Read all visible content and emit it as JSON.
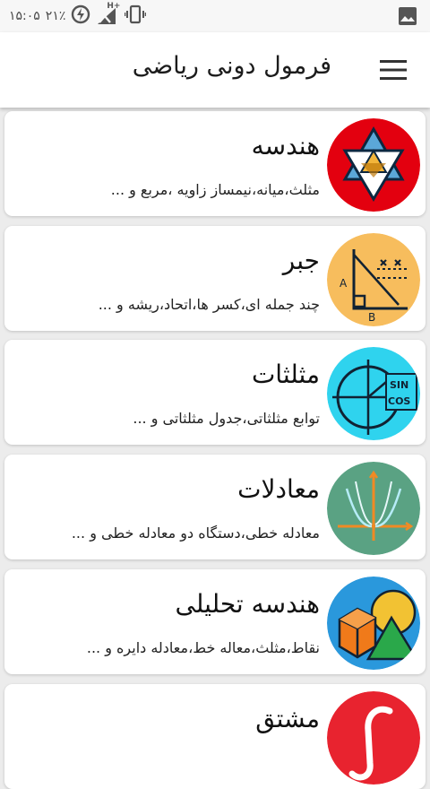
{
  "status_bar": {
    "time": "۱۵:۰۵",
    "battery_percent": "۲۱٪",
    "network_type": "H+",
    "icons": [
      "image-icon",
      "vibrate-icon",
      "signal-icon",
      "battery-saver-icon"
    ]
  },
  "app_bar": {
    "title": "فرمول دونی ریاضی",
    "menu_icon": "menu-icon"
  },
  "colors": {
    "background": "#ececec",
    "card": "#ffffff",
    "geometry": "#e3000f",
    "algebra": "#f7bd5d",
    "trigonometry": "#2fd3ee",
    "equations": "#5aa283",
    "analytic_geometry": "#2a98dc",
    "calculus": "#e8232f"
  },
  "categories": [
    {
      "title": "هندسه",
      "description": "مثلث،میانه،نیمساز زاویه ،مربع و ..."
    },
    {
      "title": "جبر",
      "description": "چند جمله ای،کسر ها،اتحاد،ریشه و ..."
    },
    {
      "title": "مثلثات",
      "description": "توابع مثلثاتی،جدول مثلثاتی و ..."
    },
    {
      "title": "معادلات",
      "description": "معادله خطی،دستگاه دو معادله خطی و ..."
    },
    {
      "title": "هندسه تحلیلی",
      "description": "نقاط،مثلث،معاله خط،معادله دایره و ..."
    },
    {
      "title": "مشتق",
      "description": ""
    }
  ],
  "icon_labels": {
    "algebra_a": "A",
    "algebra_b": "B",
    "trig_sin": "SIN",
    "trig_cos": "COS"
  }
}
